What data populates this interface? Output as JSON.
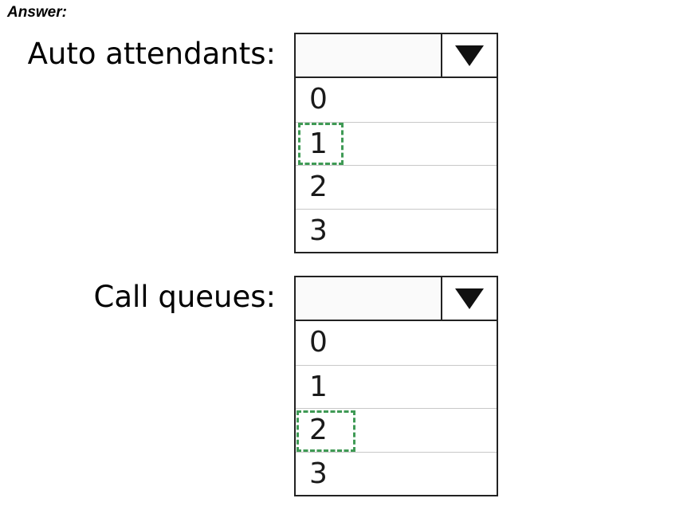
{
  "header": {
    "answer_label": "Answer:"
  },
  "questions": [
    {
      "label": "Auto attendants:",
      "options": [
        "0",
        "1",
        "2",
        "3"
      ],
      "selected_index": 1
    },
    {
      "label": "Call queues:",
      "options": [
        "0",
        "1",
        "2",
        "3"
      ],
      "selected_index": 2
    }
  ],
  "colors": {
    "selection_marker": "#3f9a55",
    "border": "#222222"
  },
  "icons": {
    "dropdown": "triangle-down-icon"
  }
}
